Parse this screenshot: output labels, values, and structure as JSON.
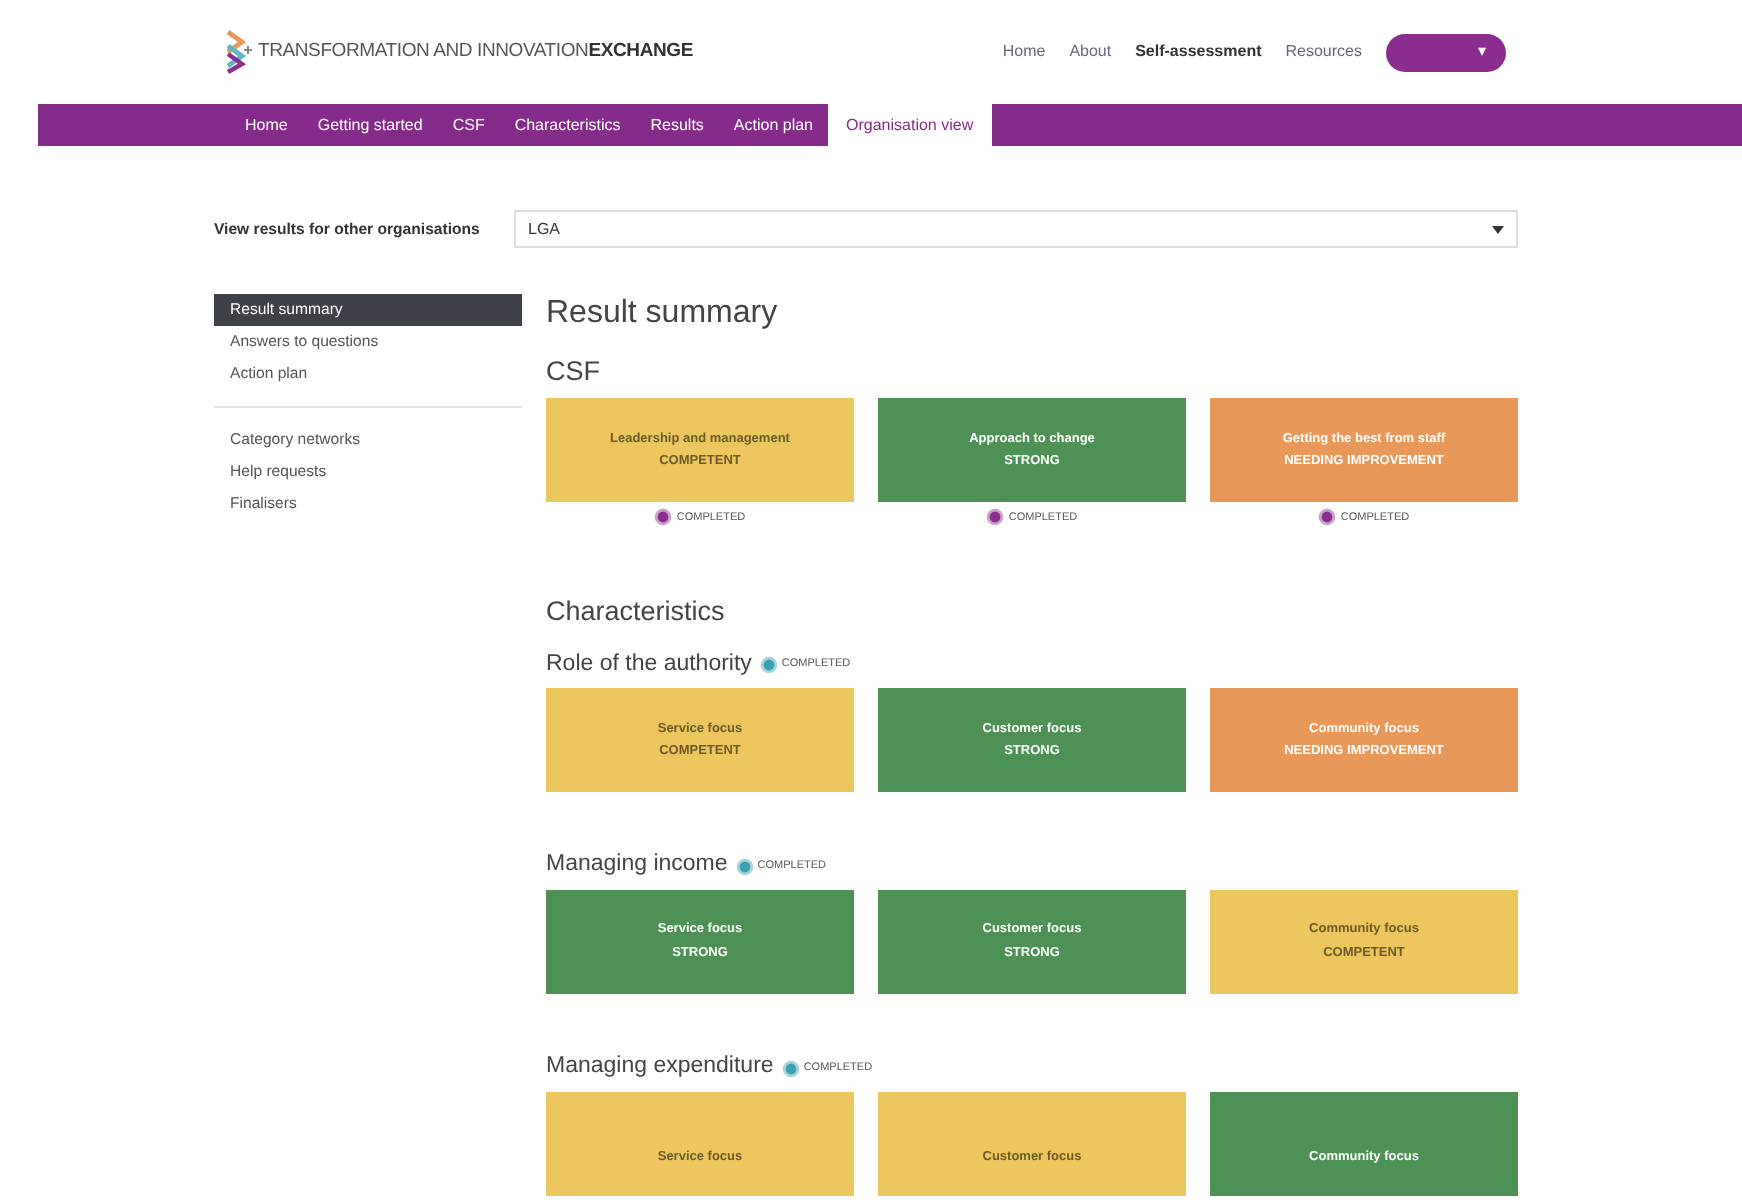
{
  "header": {
    "logo_text_light": "TRANSFORMATION AND INNOVATION",
    "logo_text_bold": "EXCHANGE",
    "nav": [
      {
        "label": "Home",
        "selected": false
      },
      {
        "label": "About",
        "selected": false
      },
      {
        "label": "Self-assessment",
        "selected": true
      },
      {
        "label": "Resources",
        "selected": false
      }
    ],
    "account_button": {
      "caret": "▾"
    }
  },
  "tabs": [
    {
      "label": "Home",
      "selected": false
    },
    {
      "label": "Getting started",
      "selected": false
    },
    {
      "label": "CSF",
      "selected": false
    },
    {
      "label": "Characteristics",
      "selected": false
    },
    {
      "label": "Results",
      "selected": false
    },
    {
      "label": "Action plan",
      "selected": false
    },
    {
      "label": "Organisation view",
      "selected": true
    }
  ],
  "org_selector": {
    "label": "View results for other organisations",
    "value": "LGA"
  },
  "sidebar": {
    "groups": [
      [
        {
          "label": "Result summary",
          "selected": true
        },
        {
          "label": "Answers to questions",
          "selected": false
        },
        {
          "label": "Action plan",
          "selected": false
        }
      ],
      [
        {
          "label": "Category networks",
          "selected": false
        },
        {
          "label": "Help requests",
          "selected": false
        },
        {
          "label": "Finalisers",
          "selected": false
        }
      ]
    ]
  },
  "main": {
    "title": "Result summary",
    "csf": {
      "title": "CSF",
      "tiles": [
        {
          "title": "Leadership and management",
          "rating": "COMPETENT",
          "kind": "competent",
          "status": "COMPLETED"
        },
        {
          "title": "Approach to change",
          "rating": "STRONG",
          "kind": "strong",
          "status": "COMPLETED"
        },
        {
          "title": "Getting the best from staff",
          "rating": "NEEDING IMPROVEMENT",
          "kind": "needing",
          "status": "COMPLETED"
        }
      ]
    },
    "characteristics": {
      "title": "Characteristics",
      "groups": [
        {
          "title": "Role of the authority",
          "status": "COMPLETED",
          "tiles": [
            {
              "title": "Service focus",
              "rating": "COMPETENT",
              "kind": "competent"
            },
            {
              "title": "Customer focus",
              "rating": "STRONG",
              "kind": "strong"
            },
            {
              "title": "Community focus",
              "rating": "NEEDING IMPROVEMENT",
              "kind": "needing"
            }
          ]
        },
        {
          "title": "Managing income",
          "status": "COMPLETED",
          "tiles": [
            {
              "title": "Service focus",
              "rating": "STRONG",
              "kind": "strong"
            },
            {
              "title": "Customer focus",
              "rating": "STRONG",
              "kind": "strong"
            },
            {
              "title": "Community focus",
              "rating": "COMPETENT",
              "kind": "competent"
            }
          ]
        },
        {
          "title": "Managing expenditure",
          "status": "COMPLETED",
          "tiles": [
            {
              "title": "Service focus",
              "kind": "competent"
            },
            {
              "title": "Customer focus",
              "kind": "competent"
            },
            {
              "title": "Community focus",
              "kind": "strong"
            }
          ]
        }
      ]
    }
  }
}
